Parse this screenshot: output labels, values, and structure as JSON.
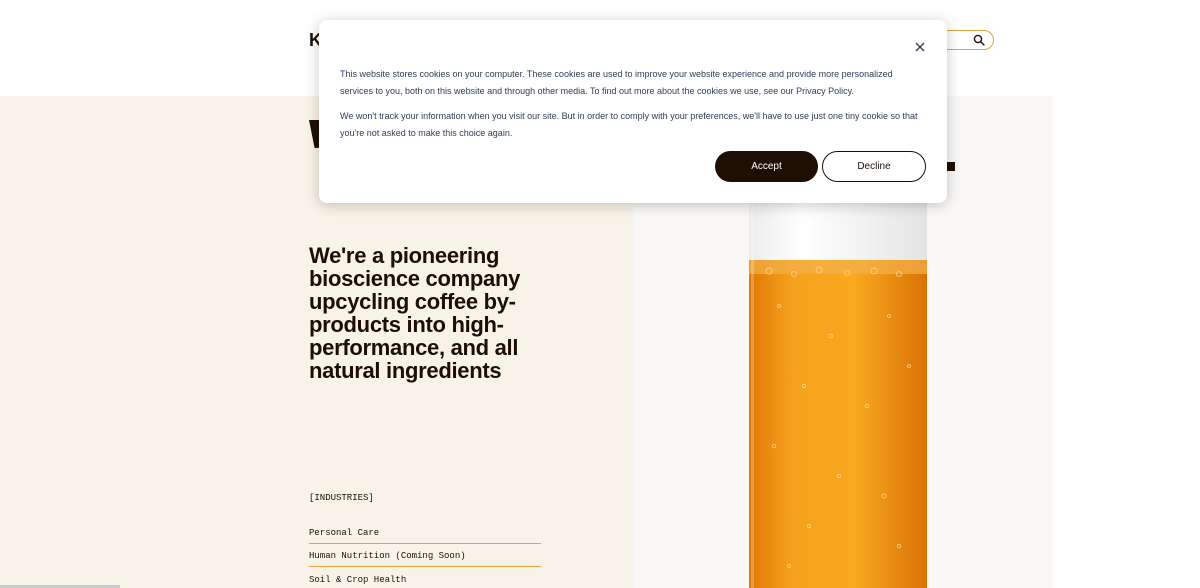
{
  "header": {
    "logo_text": "K",
    "search": {
      "icon": "search-icon"
    }
  },
  "hero": {
    "headline": "We're a pioneering bioscience company upcycling coffee by-products into high-performance, and all natural ingredients"
  },
  "industries": {
    "label": "[INDUSTRIES]",
    "items": [
      {
        "label": "Personal Care"
      },
      {
        "label": "Human Nutrition (Coming Soon)"
      },
      {
        "label": "Soil & Crop Health"
      }
    ]
  },
  "cookie_banner": {
    "paragraph1": "This website stores cookies on your computer. These cookies are used to improve your website experience and provide more personalized services to you, both on this website and through other media. To find out more about the cookies we use, see our Privacy Policy.",
    "paragraph2": "We won't track your information when you visit our site. But in order to comply with your preferences, we'll have to use just one tiny cookie so that you're not asked to make this choice again.",
    "accept_label": "Accept",
    "decline_label": "Decline",
    "close_icon": "close-icon"
  },
  "colors": {
    "brand_dark": "#1e0f05",
    "accent_orange": "#e8a33c",
    "cream_bg": "#f8f3e8",
    "link_text": "#2f3d58"
  }
}
